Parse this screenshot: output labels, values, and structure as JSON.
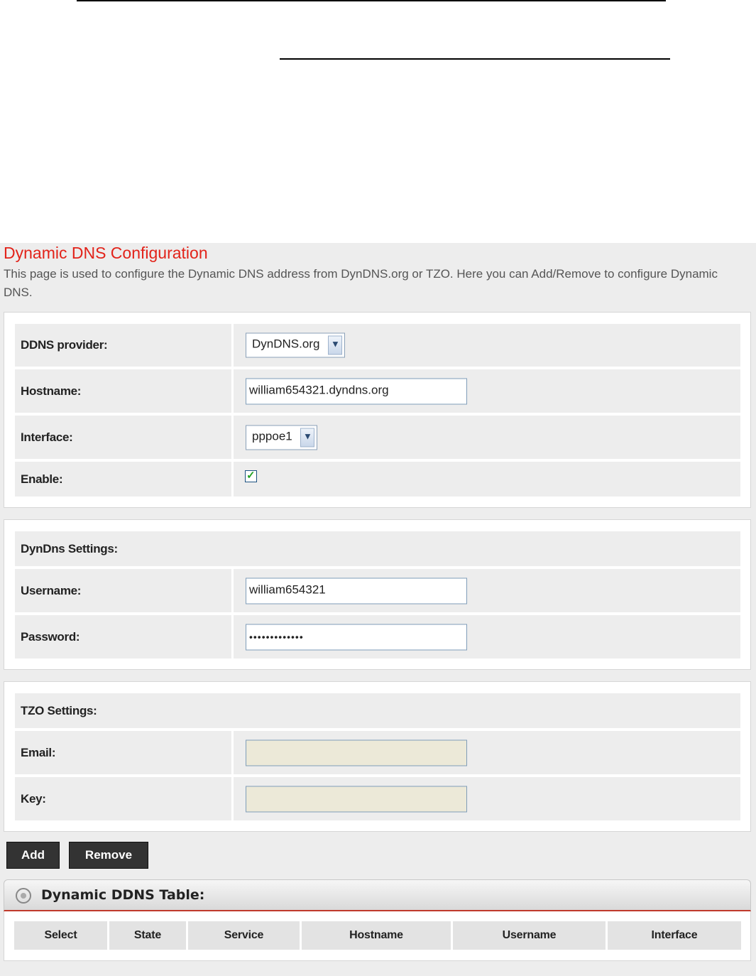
{
  "page": {
    "title": "Dynamic DNS Configuration",
    "description": "This page is used to configure the Dynamic DNS address from DynDNS.org or TZO. Here you can Add/Remove to configure Dynamic DNS."
  },
  "config": {
    "provider_label": "DDNS provider:",
    "provider_value": "DynDNS.org",
    "hostname_label": "Hostname:",
    "hostname_value": "william654321.dyndns.org",
    "interface_label": "Interface:",
    "interface_value": "pppoe1",
    "enable_label": "Enable:",
    "enable_checked": true
  },
  "dyndns": {
    "section_label": "DynDns Settings:",
    "username_label": "Username:",
    "username_value": "william654321",
    "password_label": "Password:",
    "password_value": "•••••••••••••"
  },
  "tzo": {
    "section_label": "TZO Settings:",
    "email_label": "Email:",
    "email_value": "",
    "key_label": "Key:",
    "key_value": ""
  },
  "buttons": {
    "add": "Add",
    "remove": "Remove"
  },
  "table": {
    "title": "Dynamic DDNS Table:",
    "columns": [
      "Select",
      "State",
      "Service",
      "Hostname",
      "Username",
      "Interface"
    ]
  },
  "colors": {
    "title_red": "#e2231a",
    "panel_bg": "#ededed",
    "button_bg": "#333333"
  }
}
